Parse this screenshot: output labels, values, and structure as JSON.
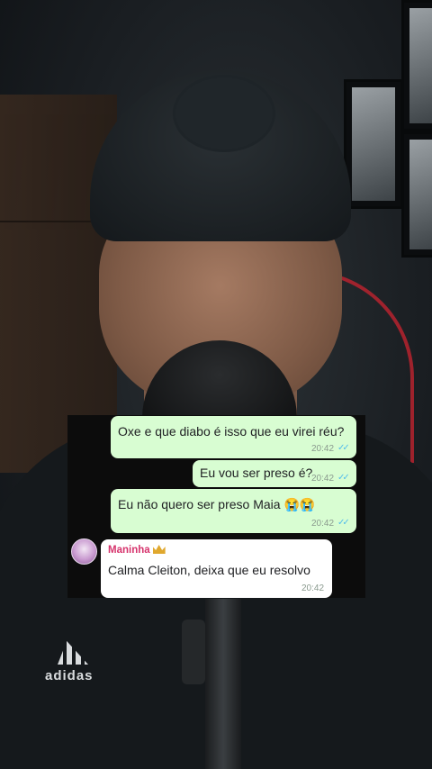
{
  "chat": {
    "messages": [
      {
        "direction": "outgoing",
        "text": "Oxe e que diabo é isso que eu virei réu?",
        "time": "20:42",
        "status": "read"
      },
      {
        "direction": "outgoing",
        "text": "Eu vou ser preso é?",
        "time": "20:42",
        "status": "read"
      },
      {
        "direction": "outgoing",
        "text": "Eu não quero ser preso Maia 😭😭",
        "time": "20:42",
        "status": "read"
      },
      {
        "direction": "incoming",
        "sender": "Maninha",
        "text": "Calma Cleiton, deixa que eu resolvo",
        "time": "20:42"
      }
    ],
    "read_ticks": "✓✓",
    "sender_icon": "crown-icon"
  },
  "background": {
    "brand_logo_text": "adidas"
  },
  "colors": {
    "outgoing_bubble": "#d8fdd2",
    "incoming_bubble": "#ffffff",
    "sender_name": "#d6336c",
    "read_ticks": "#53bdeb"
  }
}
